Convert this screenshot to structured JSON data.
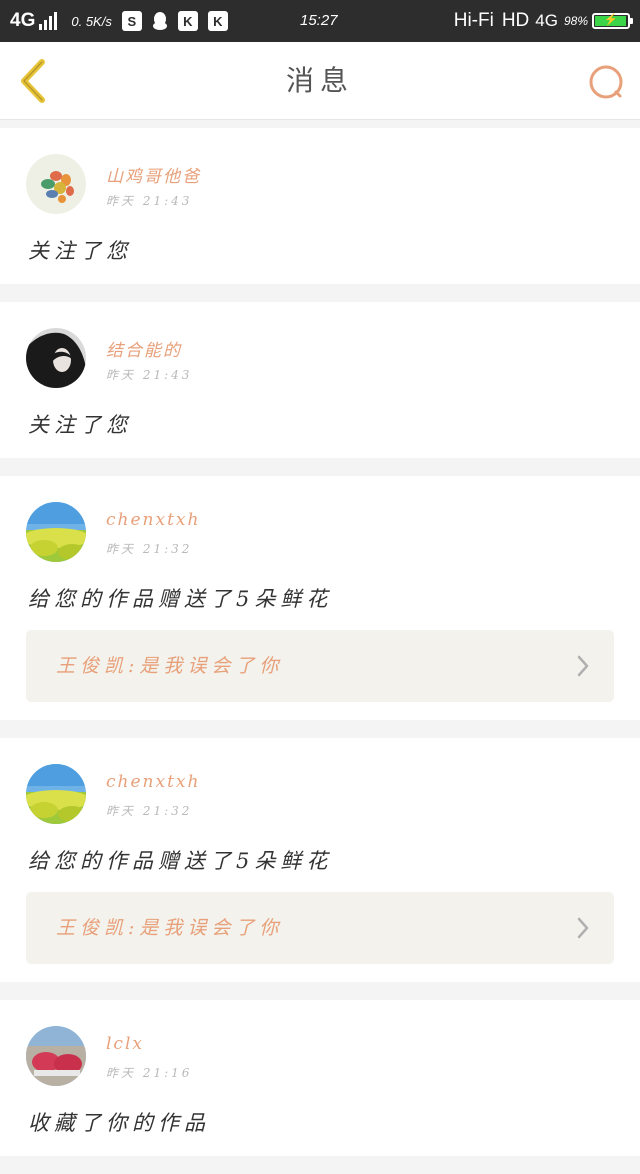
{
  "status_bar": {
    "network": "4G",
    "speed": "0. 5K/s",
    "icons": [
      "s-icon",
      "qq-icon",
      "k-icon",
      "k-icon"
    ],
    "time": "15:27",
    "hifi": "Hi-Fi",
    "hd": "HD",
    "net_right": "4G",
    "battery_text": "98%",
    "battery_level": 0.98,
    "battery_color": "#3cd448"
  },
  "header": {
    "title": "消息",
    "back_icon": "chevron-left-icon",
    "search_icon": "search-icon",
    "accent_color": "#e8a07a",
    "back_color": "#e7c437"
  },
  "messages": [
    {
      "name": "山鸡哥他爸",
      "time": "昨天 21:43",
      "text": "关注了您"
    },
    {
      "name": "结合能的",
      "time": "昨天 21:43",
      "text": "关注了您"
    },
    {
      "name": "chenxtxh",
      "time": "昨天 21:32",
      "text": "给您的作品赠送了5朵鲜花",
      "work": "王俊凯:是我误会了你"
    },
    {
      "name": "chenxtxh",
      "time": "昨天 21:32",
      "text": "给您的作品赠送了5朵鲜花",
      "work": "王俊凯:是我误会了你"
    },
    {
      "name": "lclx",
      "time": "昨天 21:16",
      "text": "收藏了你的作品"
    }
  ]
}
